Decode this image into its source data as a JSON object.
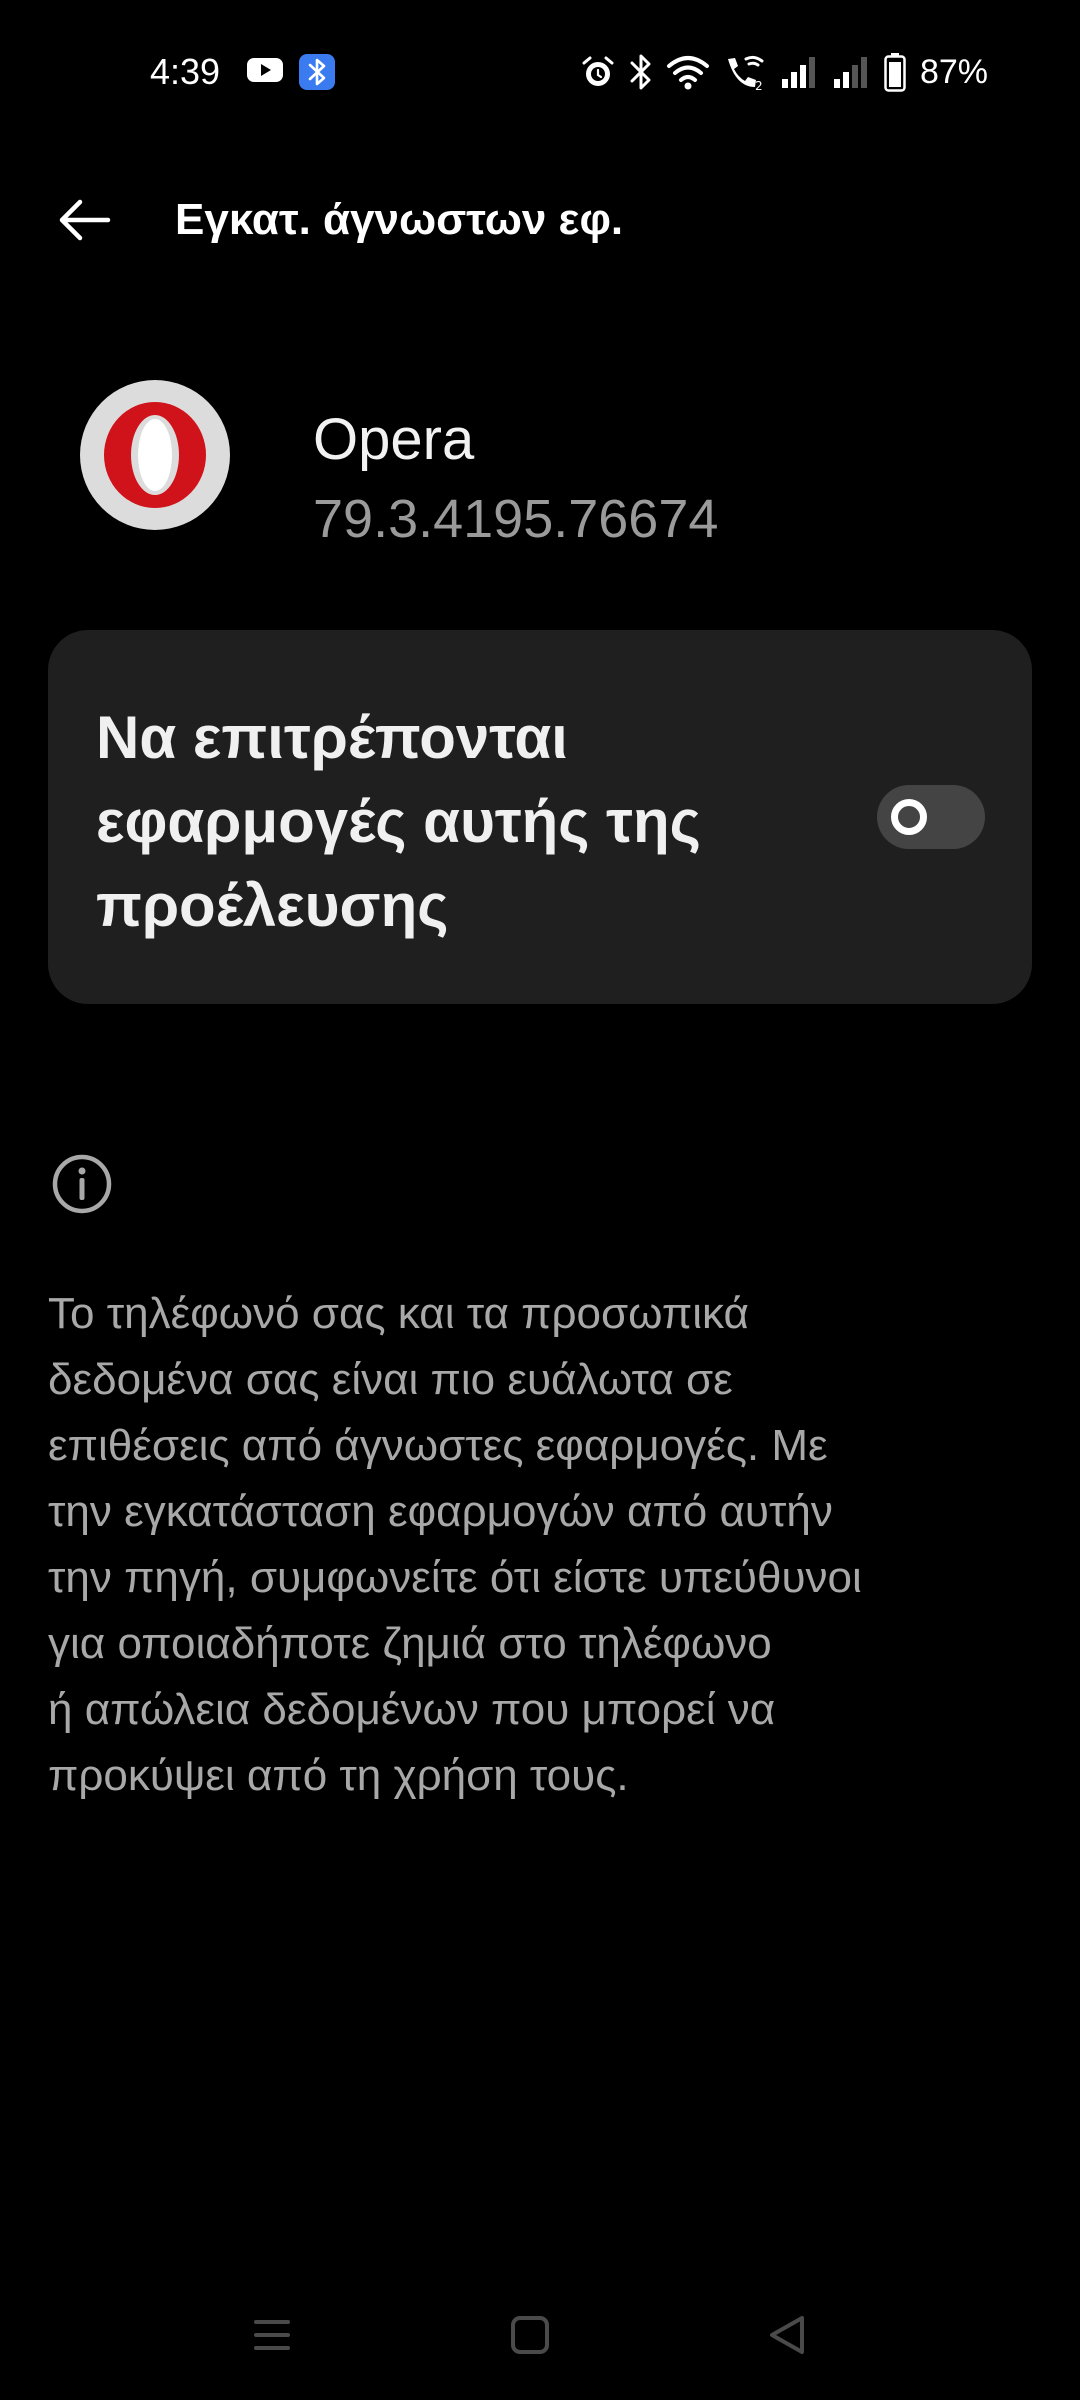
{
  "status_bar": {
    "time": "4:39",
    "battery": "87%",
    "left_icons": [
      "youtube-icon",
      "bluetooth-app-icon"
    ],
    "right_icons": [
      "alarm-icon",
      "bluetooth-icon",
      "wifi-icon",
      "wifi-calling-icon",
      "signal-sim1-icon",
      "signal-sim2-icon",
      "battery-icon"
    ]
  },
  "header": {
    "title": "Εγκατ. άγνωστων εφ.",
    "back_icon": "back-arrow-icon"
  },
  "app": {
    "name": "Opera",
    "version": "79.3.4195.76674",
    "icon": "opera-logo-icon"
  },
  "setting": {
    "label": "Να επιτρέπονται εφαρμογές αυτής της προέλευσης",
    "enabled": false
  },
  "info": {
    "icon": "info-icon",
    "text": "Το τηλέφωνό σας και τα προσωπικά\nδεδομένα σας είναι πιο ευάλωτα σε\nεπιθέσεις από άγνωστες εφαρμογές. Με\nτην εγκατάσταση εφαρμογών από αυτήν\nτην πηγή, συμφωνείτε ότι είστε υπεύθυνοι\nγια οποιαδήποτε ζημιά στο τηλέφωνο\nή απώλεια δεδομένων που μπορεί να\nπροκύψει από τη χρήση τους."
  },
  "nav_bar": {
    "items": [
      "menu-icon",
      "home-icon",
      "back-icon"
    ]
  },
  "colors": {
    "background": "#000000",
    "card": "#1f1f1f",
    "secondary_text": "#a8a8a8",
    "opera_red": "#d0121a",
    "bluetooth_badge": "#3a7bf0"
  }
}
